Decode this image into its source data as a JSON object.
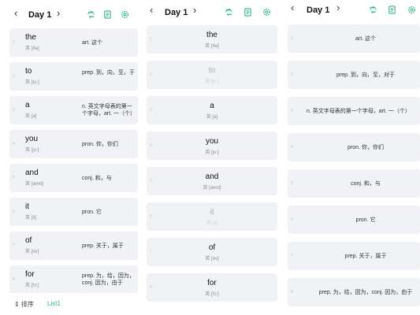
{
  "colors": {
    "accent": "#2db67c",
    "card": "#f1f2f5"
  },
  "header": {
    "day_label": "Day 1",
    "prev_icon": "chevron-left-icon",
    "next_icon": "chevron-right-icon",
    "icons": [
      "shuffle-icon",
      "book-icon",
      "settings-icon"
    ]
  },
  "panel1": {
    "words": [
      {
        "num": "1",
        "word": "the",
        "phon": "英 [ðə]",
        "meaning": "art. 这个"
      },
      {
        "num": "2",
        "word": "to",
        "phon": "英 [tu:]",
        "meaning": "prep. 到，向，至，于"
      },
      {
        "num": "3",
        "word": "a",
        "phon": "英 [ə]",
        "meaning": "n. 英文字母表的第一个字母，art. 一（个）"
      },
      {
        "num": "4",
        "word": "you",
        "phon": "英 [ju:]",
        "meaning": "pron. 你，你们"
      },
      {
        "num": "5",
        "word": "and",
        "phon": "英 [ænd]",
        "meaning": "conj. 和，与"
      },
      {
        "num": "6",
        "word": "it",
        "phon": "英 [it]",
        "meaning": "pron. 它"
      },
      {
        "num": "7",
        "word": "of",
        "phon": "英 [ɒv]",
        "meaning": "prep. 关于，属于"
      },
      {
        "num": "8",
        "word": "for",
        "phon": "英 [fɔ:]",
        "meaning": "prep. 为，给，因为，conj. 因为，由于"
      }
    ]
  },
  "footer": {
    "sort_label": "⇕ 排序",
    "list_label": "List1"
  },
  "panel2": {
    "words": [
      {
        "num": "1",
        "word": "the",
        "phon": "英 [ðə]"
      },
      {
        "num": "2",
        "word": "to",
        "phon": "英 [tu:]"
      },
      {
        "num": "3",
        "word": "a",
        "phon": "英 [ə]"
      },
      {
        "num": "4",
        "word": "you",
        "phon": "英 [ju:]"
      },
      {
        "num": "5",
        "word": "and",
        "phon": "英 [ænd]"
      },
      {
        "num": "6",
        "word": "it",
        "phon": "英 [it]"
      },
      {
        "num": "7",
        "word": "of",
        "phon": "英 [ɒv]"
      },
      {
        "num": "8",
        "word": "for",
        "phon": "英 [fɔ:]"
      }
    ]
  },
  "panel3": {
    "meanings": [
      {
        "num": "1",
        "meaning": "art. 这个"
      },
      {
        "num": "2",
        "meaning": "prep. 到，向，至，对于"
      },
      {
        "num": "3",
        "meaning": "n. 英文字母表的第一个字母，art. 一（个）"
      },
      {
        "num": "4",
        "meaning": "pron. 你，你们"
      },
      {
        "num": "5",
        "meaning": "conj. 和，与"
      },
      {
        "num": "6",
        "meaning": "pron. 它"
      },
      {
        "num": "7",
        "meaning": "prep. 关于，属于"
      },
      {
        "num": "8",
        "meaning": "prep. 为，给，因为，conj. 因为，由于"
      }
    ]
  }
}
